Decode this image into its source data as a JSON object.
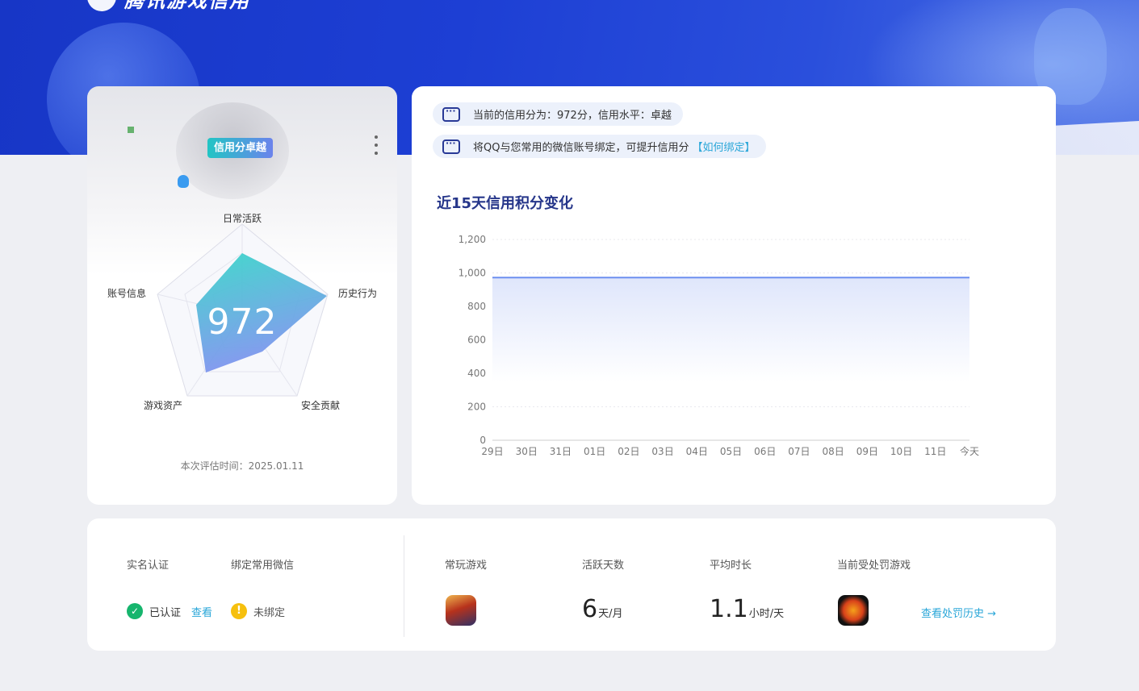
{
  "header": {
    "brand": "腾讯游戏信用"
  },
  "profile": {
    "badge": "信用分卓越",
    "score": "972",
    "radar_axes": [
      "日常活跃",
      "历史行为",
      "安全贡献",
      "游戏资产",
      "账号信息"
    ],
    "eval_label": "本次评估时间：",
    "eval_date": "2025.01.11"
  },
  "notices": [
    {
      "text": "当前的信用分为：972分，信用水平：卓越",
      "link": ""
    },
    {
      "text": "将QQ与您常用的微信账号绑定，可提升信用分",
      "link": "【如何绑定】"
    },
    {
      "text": "",
      "link": ""
    }
  ],
  "chart_section": {
    "title": "近15天信用积分变化"
  },
  "chart_data": {
    "type": "area",
    "categories": [
      "29日",
      "30日",
      "31日",
      "01日",
      "02日",
      "03日",
      "04日",
      "05日",
      "06日",
      "07日",
      "08日",
      "09日",
      "10日",
      "11日",
      "今天"
    ],
    "series": [
      {
        "values": [
          972,
          972,
          972,
          972,
          972,
          972,
          972,
          972,
          972,
          972,
          972,
          972,
          972,
          972,
          972
        ]
      }
    ],
    "yticks": [
      "0",
      "200",
      "400",
      "600",
      "800",
      "1,000",
      "1,200"
    ],
    "ylim": [
      0,
      1200
    ],
    "grid": true,
    "colors": {
      "line": "#6d8ff0",
      "fill": "#dfe6fb"
    }
  },
  "account": {
    "realname_label": "实名认证",
    "realname_status": "已认证",
    "realname_link": "查看",
    "wechat_label": "绑定常用微信",
    "wechat_status": "未绑定"
  },
  "stats": {
    "games_label": "常玩游戏",
    "games": [
      "honor-of-kings-icon"
    ],
    "active_days_label": "活跃天数",
    "active_days_value": "6",
    "active_days_unit": "天/月",
    "avg_time_label": "平均时长",
    "avg_time_value": "1.1",
    "avg_time_unit": "小时/天",
    "penalty_label": "当前受处罚游戏",
    "penalty_games": [
      "crossfire-icon"
    ],
    "history_link": "查看处罚历史",
    "history_arrow": "→"
  },
  "colors": {
    "accent": "#29a6d8",
    "brand_blue": "#1d3fd4",
    "ok": "#16b56d",
    "warn": "#f6c00e"
  }
}
